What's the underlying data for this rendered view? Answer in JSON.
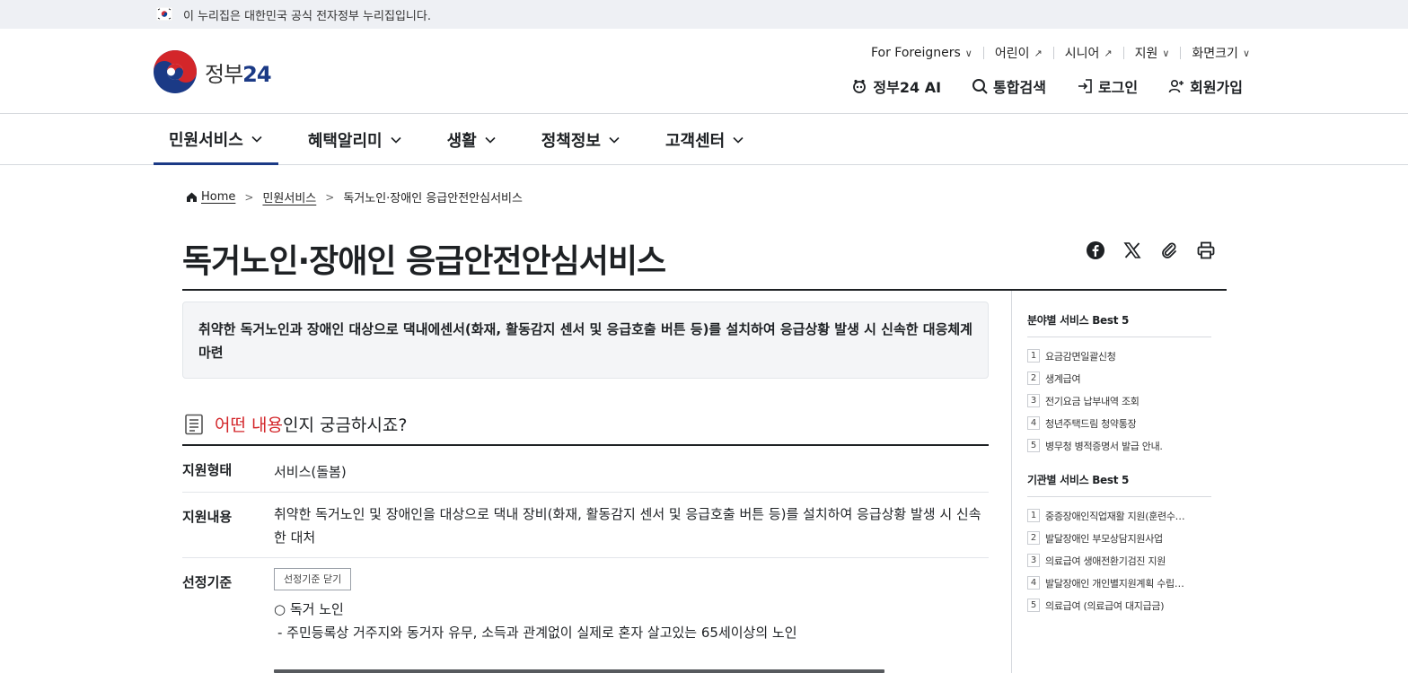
{
  "gov_banner": {
    "text": "이 누리집은 대한민국 공식 전자정부 누리집입니다."
  },
  "logo": {
    "text_prefix": "정부",
    "text_number": "24"
  },
  "utility_menu": [
    {
      "label": "For Foreigners",
      "icon": "chevron-down-icon"
    },
    {
      "label": "어린이",
      "icon": "external-link-icon"
    },
    {
      "label": "시니어",
      "icon": "external-link-icon"
    },
    {
      "label": "지원",
      "icon": "chevron-down-icon"
    },
    {
      "label": "화면크기",
      "icon": "chevron-down-icon"
    }
  ],
  "header_actions": {
    "ai": "정부24 AI",
    "search": "통합검색",
    "login": "로그인",
    "signup": "회원가입"
  },
  "gnb": [
    {
      "label": "민원서비스",
      "active": true
    },
    {
      "label": "혜택알리미",
      "active": false
    },
    {
      "label": "생활",
      "active": false
    },
    {
      "label": "정책정보",
      "active": false
    },
    {
      "label": "고객센터",
      "active": false
    }
  ],
  "breadcrumb": {
    "home": "Home",
    "level1": "민원서비스",
    "current": "독거노인·장애인 응급안전안심서비스"
  },
  "page_title": "독거노인·장애인 응급안전안심서비스",
  "summary": "취약한 독거노인과 장애인 대상으로 댁내에센서(화재, 활동감지 센서 및 응급호출 버튼 등)를 설치하여 응급상황 발생 시 신속한 대응체계 마련",
  "section": {
    "accent": "어떤 내용",
    "rest": "인지 궁금하시죠?"
  },
  "details": {
    "type_label": "지원형태",
    "type_value": "서비스(돌봄)",
    "content_label": "지원내용",
    "content_value": "취약한 독거노인 및 장애인을 대상으로 댁내 장비(화재, 활동감지 센서 및 응급호출 버튼 등)를 설치하여 응급상황 발생 시 신속한 대처",
    "criteria_label": "선정기준",
    "criteria_toggle": "선정기준 닫기",
    "criteria_item1": "○ 독거 노인",
    "criteria_item1_sub": "- 주민등록상 거주지와 동거자 유무, 소득과 관계없이 실제로 혼자 살고있는 65세이상의 노인"
  },
  "sidebar": {
    "best_by_field": {
      "title": "분야별 서비스 Best 5",
      "items": [
        "요금감면일괄신청",
        "생계급여",
        "전기요금 납부내역 조회",
        "청년주택드림 청약통장",
        "병무청 병적증명서 발급 안내."
      ]
    },
    "best_by_agency": {
      "title": "기관별 서비스 Best 5",
      "items": [
        "중증장애인직업재활 지원(훈련수…",
        "발달장애인 부모상담지원사업",
        "의료급여 생애전환기검진 지원",
        "발달장애인 개인별지원계획 수립…",
        "의료급여 (의료급여 대지급금)"
      ]
    }
  },
  "colors": {
    "brand_navy": "#1b3a86",
    "accent_red": "#d3262a"
  }
}
